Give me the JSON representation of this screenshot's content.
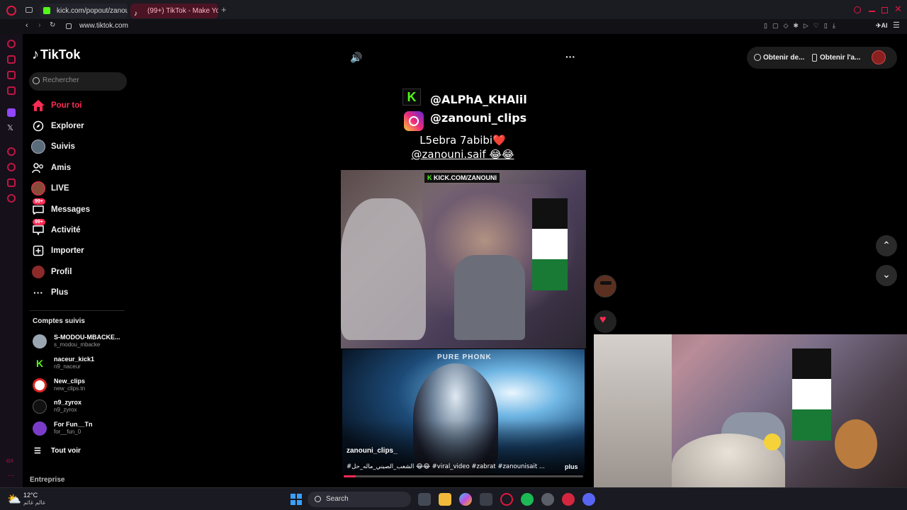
{
  "browser": {
    "tabs": [
      {
        "label": "kick.com/popout/zanouni/",
        "color": "#53fc18"
      },
      {
        "label": "(99+) TikTok - Make Yo",
        "color": "#fe2c55"
      }
    ],
    "url": "www.tiktok.com"
  },
  "tiktok": {
    "logo": "TikTok",
    "search_placeholder": "Rechercher",
    "nav": [
      {
        "label": "Pour toi",
        "icon": "home-icon",
        "active": true
      },
      {
        "label": "Explorer",
        "icon": "compass-icon"
      },
      {
        "label": "Suivis",
        "icon": "avatar-icon"
      },
      {
        "label": "Amis",
        "icon": "friends-icon"
      },
      {
        "label": "LIVE",
        "icon": "live-icon"
      },
      {
        "label": "Messages",
        "icon": "messages-icon",
        "badge": "99+"
      },
      {
        "label": "Activité",
        "icon": "activity-icon",
        "badge": "99+"
      },
      {
        "label": "Importer",
        "icon": "upload-icon"
      },
      {
        "label": "Profil",
        "icon": "profile-icon"
      },
      {
        "label": "Plus",
        "icon": "more-icon"
      }
    ],
    "following_title": "Comptes suivis",
    "following": [
      {
        "name": "S-MODOU-MBACKE...",
        "handle": "s_modou_mbacke"
      },
      {
        "name": "naceur_kick1",
        "handle": "n9_naceur"
      },
      {
        "name": "New_clips",
        "handle": "new_clips.tn"
      },
      {
        "name": "n9_zyrox",
        "handle": "n9_zyrox"
      },
      {
        "name": "For Fun__Tn",
        "handle": "for__fun_0"
      }
    ],
    "see_all": "Tout voir",
    "company": "Entreprise",
    "top_buttons": [
      "Obtenir de...",
      "Obtenir l'a..."
    ]
  },
  "video": {
    "overlay_handles": [
      "@ALPhA_KHAlil",
      "@zanouni_clips"
    ],
    "caption_line1": "L5ebra 7abibi❤️",
    "caption_line2": "@zanouni.saif 😂😂",
    "watermark_top": "KICK.COM/ZANOUNI",
    "watermark_bottom": "PURE PHONK",
    "author": "zanouni_clips_",
    "description": "#الشعب_الصيني_ماله_حل 😂😂 #viral_video #zabrat #zanounisait ...",
    "more": "plus",
    "progress": 0.05
  },
  "taskbar": {
    "temperature": "12°C",
    "weather_text": "عالم غائم",
    "search": "Search"
  }
}
